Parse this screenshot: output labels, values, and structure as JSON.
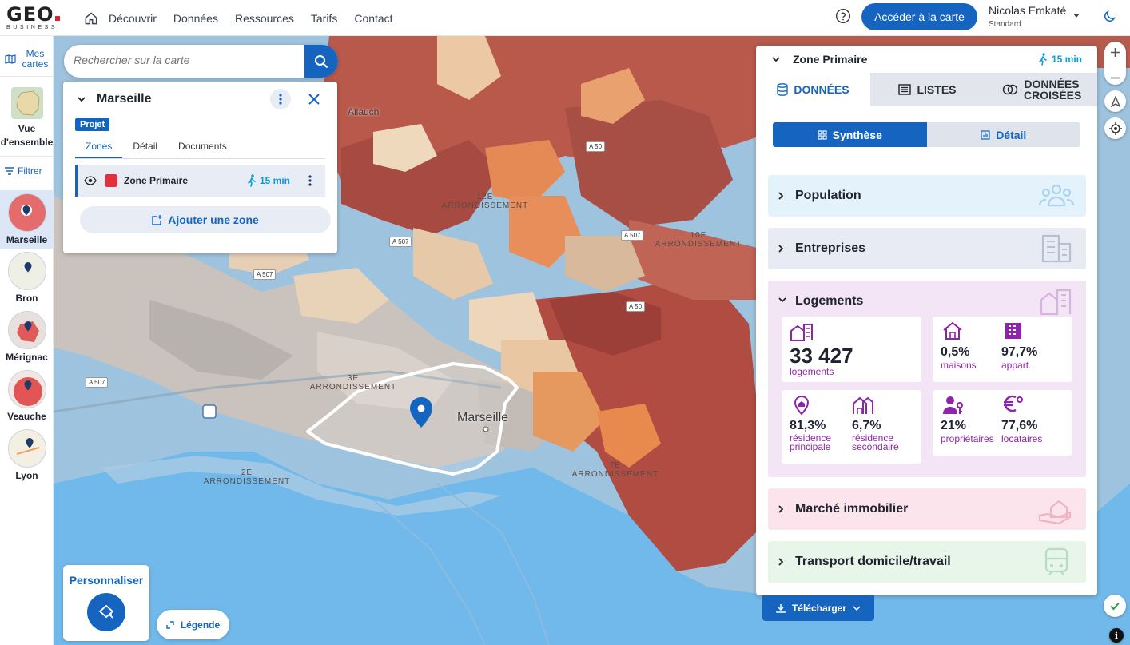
{
  "app": {
    "logo_text": "GEO",
    "logo_sub": "BUSINESS"
  },
  "nav": {
    "items": [
      "Découvrir",
      "Données",
      "Ressources",
      "Tarifs",
      "Contact"
    ],
    "cta_label": "Accéder à la carte",
    "user_name": "Nicolas Emkaté",
    "user_plan": "Standard"
  },
  "sidebar": {
    "mes_cartes": "Mes cartes",
    "vue_label": "Vue d'ensemble",
    "filtrer": "Filtrer",
    "projects": [
      {
        "label": "Marseille",
        "active": true
      },
      {
        "label": "Bron",
        "active": false
      },
      {
        "label": "Mérignac",
        "active": false
      },
      {
        "label": "Veauche",
        "active": false
      },
      {
        "label": "Lyon",
        "active": false
      }
    ]
  },
  "search": {
    "placeholder": "Rechercher sur la carte"
  },
  "project": {
    "title": "Marseille",
    "badge": "Projet",
    "tabs": [
      "Zones",
      "Détail",
      "Documents"
    ],
    "active_tab": "Zones",
    "zone": {
      "name": "Zone Primaire",
      "time": "15 min",
      "color": "#e0313e"
    },
    "add_zone": "Ajouter une zone"
  },
  "map": {
    "labels": {
      "arr12": "12E ARRONDISSEMENT",
      "arr10": "10E ARRONDISSEMENT",
      "arr3": "3E ARRONDISSEMENT",
      "arr2": "2E ARRONDISSEMENT",
      "arr7": "7E ARRONDISSEMENT",
      "city": "Marseille",
      "allauch": "Allauch"
    },
    "roads": [
      "A 507",
      "A 50",
      "A 507",
      "A 50",
      "A 507",
      "A 507"
    ]
  },
  "personnaliser": "Personnaliser",
  "legende": "Légende",
  "panel": {
    "zone_title": "Zone Primaire",
    "zone_time": "15 min",
    "tabs": [
      {
        "label": "DONNÉES",
        "active": true
      },
      {
        "label": "LISTES",
        "active": false
      },
      {
        "label": "DONNÉES CROISÉES",
        "active": false
      }
    ],
    "seg": {
      "synthese": "Synthèse",
      "detail": "Détail"
    },
    "sections": {
      "population": "Population",
      "entreprises": "Entreprises",
      "logements": "Logements",
      "marche": "Marché immobilier",
      "transport": "Transport domicile/travail"
    },
    "logements": {
      "total_value": "33 427",
      "total_label": "logements",
      "maisons_value": "0,5%",
      "maisons_label": "maisons",
      "appart_value": "97,7%",
      "appart_label": "appart.",
      "rp_value": "81,3%",
      "rp_label": "résidence principale",
      "rs_value": "6,7%",
      "rs_label": "résidence secondaire",
      "prop_value": "21%",
      "prop_label": "propriétaires",
      "loc_value": "77,6%",
      "loc_label": "locataires"
    },
    "telecharger": "Télécharger"
  },
  "colors": {
    "primary": "#1565c0",
    "zone": "#e0313e",
    "walk": "#0b9bd6",
    "logement_purple": "#8e24aa",
    "population_bg": "#e3f2fb",
    "entreprises_bg": "#e8ebf3",
    "logements_bg": "#f3e5f5",
    "marche_bg": "#fce4ec",
    "transport_bg": "#e8f5e9"
  }
}
